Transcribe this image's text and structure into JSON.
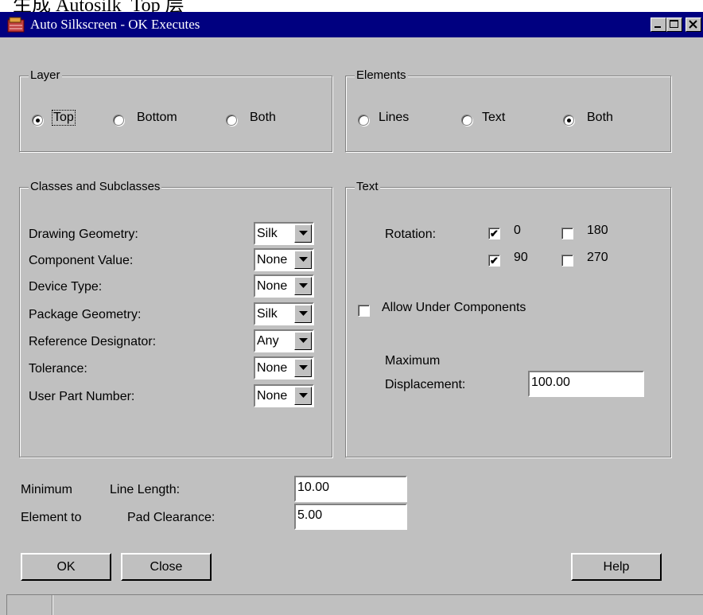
{
  "page_caption": "生成 Autosilk_Top 层",
  "window": {
    "title": "Auto Silkscreen - OK Executes",
    "controls": [
      "minimize-icon",
      "maximize-icon",
      "close-icon"
    ]
  },
  "layer": {
    "legend": "Layer",
    "options": [
      "Top",
      "Bottom",
      "Both"
    ],
    "selected": "Top"
  },
  "elements": {
    "legend": "Elements",
    "options": [
      "Lines",
      "Text",
      "Both"
    ],
    "selected": "Both"
  },
  "classes": {
    "legend": "Classes and Subclasses",
    "rows": [
      {
        "label": "Drawing Geometry:",
        "value": "Silk"
      },
      {
        "label": "Component Value:",
        "value": "None"
      },
      {
        "label": "Device Type:",
        "value": "None"
      },
      {
        "label": "Package Geometry:",
        "value": "Silk"
      },
      {
        "label": "Reference Designator:",
        "value": "Any"
      },
      {
        "label": "Tolerance:",
        "value": "None"
      },
      {
        "label": "User Part Number:",
        "value": "None"
      }
    ]
  },
  "text": {
    "legend": "Text",
    "rotation_label": "Rotation:",
    "rotations": [
      {
        "label": "0",
        "checked": true
      },
      {
        "label": "180",
        "checked": false
      },
      {
        "label": "90",
        "checked": true
      },
      {
        "label": "270",
        "checked": false
      }
    ],
    "allow_under_label": "Allow Under Components",
    "allow_under_checked": false,
    "maximum_label": "Maximum",
    "displacement_label": "Displacement:",
    "displacement_value": "100.00"
  },
  "bottom": {
    "min_label_1": "Minimum",
    "min_label_2": "Line Length:",
    "min_value": "10.00",
    "elem_label_1": "Element to",
    "elem_label_2": "Pad Clearance:",
    "elem_value": "5.00"
  },
  "buttons": {
    "ok": "OK",
    "close": "Close",
    "help": "Help"
  }
}
